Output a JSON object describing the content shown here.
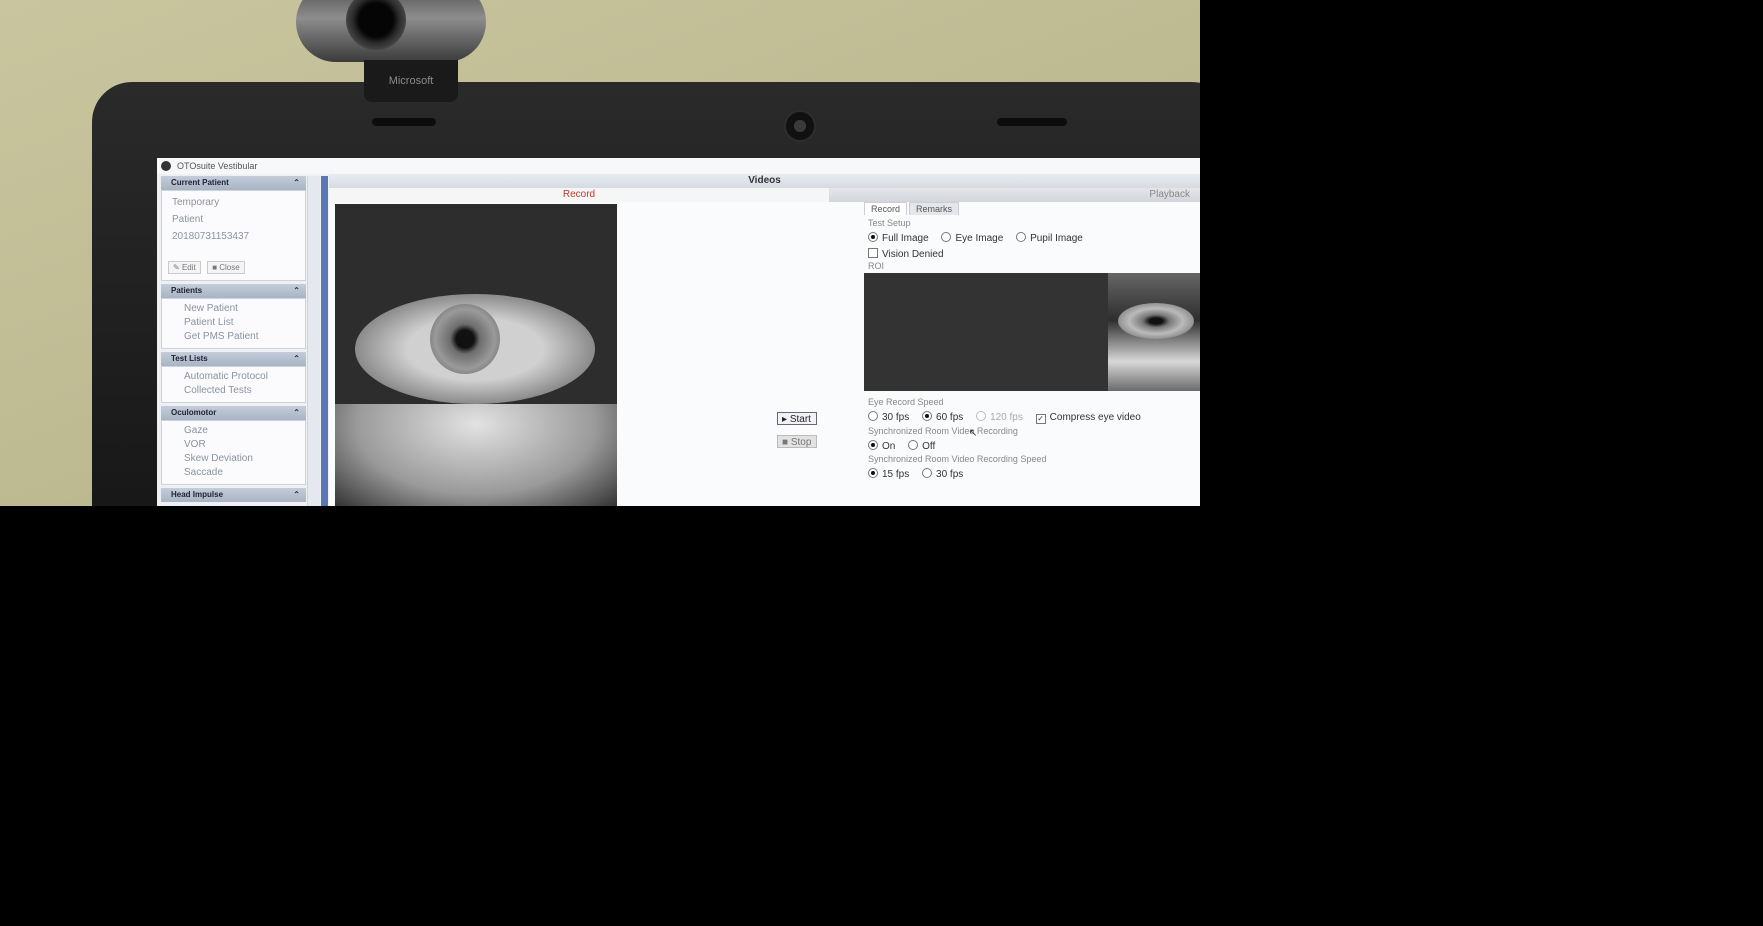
{
  "app": {
    "title": "OTOsuite Vestibular"
  },
  "webcam": {
    "brand": "Microsoft"
  },
  "sidebar": {
    "current_patient": {
      "header": "Current Patient",
      "lines": [
        "Temporary",
        "Patient",
        "20180731153437"
      ],
      "edit_label": "Edit",
      "close_label": "Close"
    },
    "patients": {
      "header": "Patients",
      "items": [
        "New Patient",
        "Patient List",
        "Get PMS Patient"
      ]
    },
    "test_lists": {
      "header": "Test Lists",
      "items": [
        "Automatic Protocol",
        "Collected Tests"
      ]
    },
    "oculomotor": {
      "header": "Oculomotor",
      "items": [
        "Gaze",
        "VOR",
        "Skew Deviation",
        "Saccade"
      ]
    },
    "head_impulse": {
      "header": "Head Impulse"
    }
  },
  "main": {
    "header": "Videos",
    "record_tab": "Record",
    "playback_tab": "Playback",
    "start_label": "Start",
    "stop_label": "Stop",
    "tabs": [
      "Record",
      "Remarks"
    ],
    "test_setup": {
      "label": "Test Setup",
      "options": [
        "Full Image",
        "Eye Image",
        "Pupil Image"
      ],
      "selected": "Full Image",
      "vision_denied": "Vision Denied"
    },
    "roi_label": "ROI",
    "eye_record_speed": {
      "label": "Eye Record Speed",
      "options": [
        "30 fps",
        "60 fps",
        "120 fps"
      ],
      "selected": "60 fps",
      "compress_label": "Compress eye video"
    },
    "sync_recording": {
      "label": "Synchronized Room Video Recording",
      "options": [
        "On",
        "Off"
      ],
      "selected": "On"
    },
    "sync_speed": {
      "label": "Synchronized Room Video Recording Speed",
      "options": [
        "15 fps",
        "30 fps"
      ],
      "selected": "15 fps"
    }
  }
}
